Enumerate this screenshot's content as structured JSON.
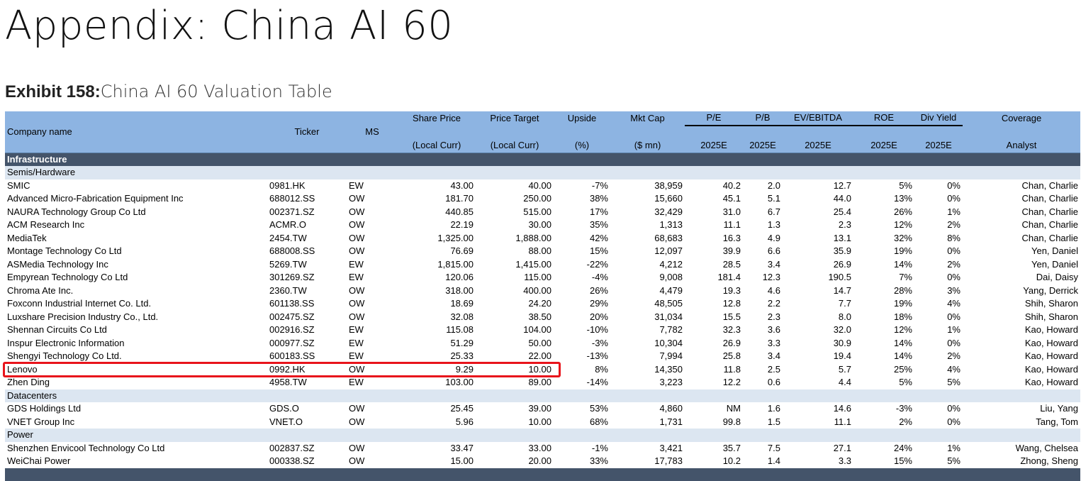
{
  "title": "Appendix: China AI 60",
  "exhibit": {
    "number": "Exhibit 158:",
    "caption": "China AI 60 Valuation Table"
  },
  "headers": {
    "company": "Company name",
    "ticker": "Ticker",
    "ms": "MS",
    "share_price": [
      "Share Price",
      "(Local Curr)"
    ],
    "price_target": [
      "Price Target",
      "(Local Curr)"
    ],
    "upside": [
      "Upside",
      "(%)"
    ],
    "mkt_cap": [
      "Mkt Cap",
      "($ mn)"
    ],
    "pe": [
      "P/E",
      "2025E"
    ],
    "pb": [
      "P/B",
      "2025E"
    ],
    "ev_ebitda": [
      "EV/EBITDA",
      "2025E"
    ],
    "roe": [
      "ROE",
      "2025E"
    ],
    "div_yield": [
      "Div Yield",
      "2025E"
    ],
    "coverage": [
      "Coverage",
      "Analyst"
    ]
  },
  "section": "Infrastructure",
  "groups": [
    {
      "name": "Semis/Hardware",
      "rows": [
        {
          "company": "SMIC",
          "ticker": "0981.HK",
          "ms": "EW",
          "price": "43.00",
          "target": "40.00",
          "upside": "-7%",
          "mktcap": "38,959",
          "pe": "40.2",
          "pb": "2.0",
          "ev": "12.7",
          "roe": "5%",
          "div": "0%",
          "analyst": "Chan, Charlie"
        },
        {
          "company": "Advanced Micro-Fabrication Equipment Inc",
          "ticker": "688012.SS",
          "ms": "OW",
          "price": "181.70",
          "target": "250.00",
          "upside": "38%",
          "mktcap": "15,660",
          "pe": "45.1",
          "pb": "5.1",
          "ev": "44.0",
          "roe": "13%",
          "div": "0%",
          "analyst": "Chan, Charlie"
        },
        {
          "company": "NAURA Technology Group Co Ltd",
          "ticker": "002371.SZ",
          "ms": "OW",
          "price": "440.85",
          "target": "515.00",
          "upside": "17%",
          "mktcap": "32,429",
          "pe": "31.0",
          "pb": "6.7",
          "ev": "25.4",
          "roe": "26%",
          "div": "1%",
          "analyst": "Chan, Charlie"
        },
        {
          "company": "ACM Research Inc",
          "ticker": "ACMR.O",
          "ms": "OW",
          "price": "22.19",
          "target": "30.00",
          "upside": "35%",
          "mktcap": "1,313",
          "pe": "11.1",
          "pb": "1.3",
          "ev": "2.3",
          "roe": "12%",
          "div": "2%",
          "analyst": "Chan, Charlie"
        },
        {
          "company": "MediaTek",
          "ticker": "2454.TW",
          "ms": "OW",
          "price": "1,325.00",
          "target": "1,888.00",
          "upside": "42%",
          "mktcap": "68,683",
          "pe": "16.3",
          "pb": "4.9",
          "ev": "13.1",
          "roe": "32%",
          "div": "8%",
          "analyst": "Chan, Charlie"
        },
        {
          "company": "Montage Technology Co Ltd",
          "ticker": "688008.SS",
          "ms": "OW",
          "price": "76.69",
          "target": "88.00",
          "upside": "15%",
          "mktcap": "12,097",
          "pe": "39.9",
          "pb": "6.6",
          "ev": "35.9",
          "roe": "19%",
          "div": "0%",
          "analyst": "Yen, Daniel"
        },
        {
          "company": "ASMedia Technology Inc",
          "ticker": "5269.TW",
          "ms": "EW",
          "price": "1,815.00",
          "target": "1,415.00",
          "upside": "-22%",
          "mktcap": "4,212",
          "pe": "28.5",
          "pb": "3.4",
          "ev": "26.9",
          "roe": "14%",
          "div": "2%",
          "analyst": "Yen, Daniel"
        },
        {
          "company": "Empyrean Technology Co Ltd",
          "ticker": "301269.SZ",
          "ms": "EW",
          "price": "120.06",
          "target": "115.00",
          "upside": "-4%",
          "mktcap": "9,008",
          "pe": "181.4",
          "pb": "12.3",
          "ev": "190.5",
          "roe": "7%",
          "div": "0%",
          "analyst": "Dai, Daisy"
        },
        {
          "company": "Chroma Ate Inc.",
          "ticker": "2360.TW",
          "ms": "OW",
          "price": "318.00",
          "target": "400.00",
          "upside": "26%",
          "mktcap": "4,479",
          "pe": "19.3",
          "pb": "4.6",
          "ev": "14.7",
          "roe": "28%",
          "div": "3%",
          "analyst": "Yang, Derrick"
        },
        {
          "company": "Foxconn Industrial Internet Co. Ltd.",
          "ticker": "601138.SS",
          "ms": "OW",
          "price": "18.69",
          "target": "24.20",
          "upside": "29%",
          "mktcap": "48,505",
          "pe": "12.8",
          "pb": "2.2",
          "ev": "7.7",
          "roe": "19%",
          "div": "4%",
          "analyst": "Shih, Sharon"
        },
        {
          "company": "Luxshare Precision Industry Co., Ltd.",
          "ticker": "002475.SZ",
          "ms": "OW",
          "price": "32.08",
          "target": "38.50",
          "upside": "20%",
          "mktcap": "31,034",
          "pe": "15.5",
          "pb": "2.3",
          "ev": "8.0",
          "roe": "18%",
          "div": "0%",
          "analyst": "Shih, Sharon"
        },
        {
          "company": "Shennan Circuits Co Ltd",
          "ticker": "002916.SZ",
          "ms": "EW",
          "price": "115.08",
          "target": "104.00",
          "upside": "-10%",
          "mktcap": "7,782",
          "pe": "32.3",
          "pb": "3.6",
          "ev": "32.0",
          "roe": "12%",
          "div": "1%",
          "analyst": "Kao, Howard"
        },
        {
          "company": "Inspur Electronic Information",
          "ticker": "000977.SZ",
          "ms": "EW",
          "price": "51.29",
          "target": "50.00",
          "upside": "-3%",
          "mktcap": "10,304",
          "pe": "26.9",
          "pb": "3.3",
          "ev": "30.9",
          "roe": "14%",
          "div": "0%",
          "analyst": "Kao, Howard"
        },
        {
          "company": "Shengyi Technology Co Ltd.",
          "ticker": "600183.SS",
          "ms": "EW",
          "price": "25.33",
          "target": "22.00",
          "upside": "-13%",
          "mktcap": "7,994",
          "pe": "25.8",
          "pb": "3.4",
          "ev": "19.4",
          "roe": "14%",
          "div": "2%",
          "analyst": "Kao, Howard"
        },
        {
          "company": "Lenovo",
          "ticker": "0992.HK",
          "ms": "OW",
          "price": "9.29",
          "target": "10.00",
          "upside": "8%",
          "mktcap": "14,350",
          "pe": "11.8",
          "pb": "2.5",
          "ev": "5.7",
          "roe": "25%",
          "div": "4%",
          "analyst": "Kao, Howard"
        },
        {
          "company": "Zhen Ding",
          "ticker": "4958.TW",
          "ms": "EW",
          "price": "103.00",
          "target": "89.00",
          "upside": "-14%",
          "mktcap": "3,223",
          "pe": "12.2",
          "pb": "0.6",
          "ev": "4.4",
          "roe": "5%",
          "div": "5%",
          "analyst": "Kao, Howard"
        }
      ]
    },
    {
      "name": "Datacenters",
      "rows": [
        {
          "company": "GDS Holdings Ltd",
          "ticker": "GDS.O",
          "ms": "OW",
          "price": "25.45",
          "target": "39.00",
          "upside": "53%",
          "mktcap": "4,860",
          "pe": "NM",
          "pb": "1.6",
          "ev": "14.6",
          "roe": "-3%",
          "div": "0%",
          "analyst": "Liu, Yang"
        },
        {
          "company": "VNET Group Inc",
          "ticker": "VNET.O",
          "ms": "OW",
          "price": "5.96",
          "target": "10.00",
          "upside": "68%",
          "mktcap": "1,731",
          "pe": "99.8",
          "pb": "1.5",
          "ev": "11.1",
          "roe": "2%",
          "div": "0%",
          "analyst": "Tang, Tom"
        }
      ]
    },
    {
      "name": "Power",
      "rows": [
        {
          "company": "Shenzhen Envicool Technology Co Ltd",
          "ticker": "002837.SZ",
          "ms": "OW",
          "price": "33.47",
          "target": "33.00",
          "upside": "-1%",
          "mktcap": "3,421",
          "pe": "35.7",
          "pb": "7.5",
          "ev": "27.1",
          "roe": "24%",
          "div": "1%",
          "analyst": "Wang, Chelsea"
        },
        {
          "company": "WeiChai Power",
          "ticker": "000338.SZ",
          "ms": "OW",
          "price": "15.00",
          "target": "20.00",
          "upside": "33%",
          "mktcap": "17,783",
          "pe": "10.2",
          "pb": "1.4",
          "ev": "3.3",
          "roe": "15%",
          "div": "5%",
          "analyst": "Zhong, Sheng"
        }
      ]
    }
  ],
  "highlight_color": "#e8141b",
  "header_color": "#8db4e2",
  "section_color": "#44546a",
  "subsection_color": "#dce6f1"
}
